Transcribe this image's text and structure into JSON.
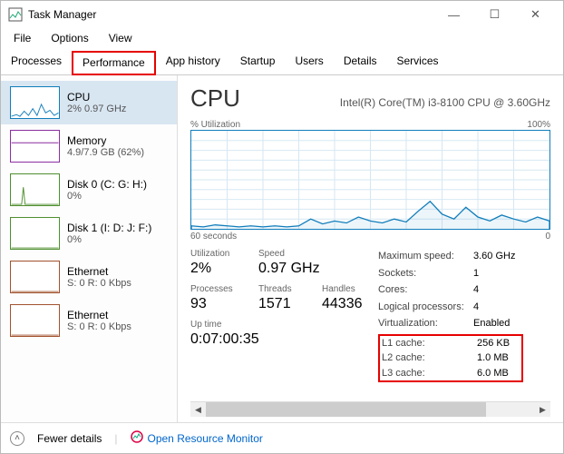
{
  "window": {
    "title": "Task Manager"
  },
  "menu": [
    "File",
    "Options",
    "View"
  ],
  "tabs": [
    "Processes",
    "Performance",
    "App history",
    "Startup",
    "Users",
    "Details",
    "Services"
  ],
  "active_tab": 1,
  "sidebar": {
    "items": [
      {
        "title": "CPU",
        "sub": "2% 0.97 GHz",
        "color": "#117dbb"
      },
      {
        "title": "Memory",
        "sub": "4.9/7.9 GB (62%)",
        "color": "#8b2fa0"
      },
      {
        "title": "Disk 0 (C: G: H:)",
        "sub": "0%",
        "color": "#4f8f2f"
      },
      {
        "title": "Disk 1 (I: D: J: F:)",
        "sub": "0%",
        "color": "#4f8f2f"
      },
      {
        "title": "Ethernet",
        "sub": "S: 0 R: 0 Kbps",
        "color": "#a0522d"
      },
      {
        "title": "Ethernet",
        "sub": "S: 0 R: 0 Kbps",
        "color": "#a0522d"
      }
    ],
    "selected": 0
  },
  "main": {
    "title": "CPU",
    "subtitle": "Intel(R) Core(TM) i3-8100 CPU @ 3.60GHz",
    "chart_top_left": "% Utilization",
    "chart_top_right": "100%",
    "chart_bottom_left": "60 seconds",
    "chart_bottom_right": "0",
    "stats_left": [
      {
        "label": "Utilization",
        "val": "2%"
      },
      {
        "label": "Processes",
        "val": "93"
      },
      {
        "label": "Up time",
        "val": ""
      }
    ],
    "stats_mid": [
      {
        "label": "Speed",
        "val": "0.97 GHz"
      },
      {
        "label": "Threads",
        "val": "1571"
      }
    ],
    "stats_right": [
      {
        "label": "Handles",
        "val": "44336"
      }
    ],
    "uptime": "0:07:00:35",
    "kv": [
      {
        "k": "Maximum speed:",
        "v": "3.60 GHz"
      },
      {
        "k": "Sockets:",
        "v": "1"
      },
      {
        "k": "Cores:",
        "v": "4"
      },
      {
        "k": "Logical processors:",
        "v": "4"
      },
      {
        "k": "Virtualization:",
        "v": "Enabled"
      }
    ],
    "cache": [
      {
        "k": "L1 cache:",
        "v": "256 KB"
      },
      {
        "k": "L2 cache:",
        "v": "1.0 MB"
      },
      {
        "k": "L3 cache:",
        "v": "6.0 MB"
      }
    ]
  },
  "footer": {
    "fewer": "Fewer details",
    "resmon": "Open Resource Monitor"
  },
  "chart_data": {
    "type": "line",
    "title": "% Utilization",
    "ylabel": "% Utilization",
    "ylim": [
      0,
      100
    ],
    "xlabel": "60 seconds",
    "x": [
      0,
      2,
      4,
      6,
      8,
      10,
      12,
      14,
      16,
      18,
      20,
      22,
      24,
      26,
      28,
      30,
      32,
      34,
      36,
      38,
      40,
      42,
      44,
      46,
      48,
      50,
      52,
      54,
      56,
      58,
      60
    ],
    "values": [
      3,
      2,
      4,
      3,
      2,
      3,
      2,
      3,
      2,
      3,
      10,
      5,
      8,
      6,
      12,
      8,
      6,
      10,
      7,
      18,
      28,
      15,
      10,
      22,
      12,
      8,
      14,
      10,
      7,
      12,
      8
    ]
  }
}
